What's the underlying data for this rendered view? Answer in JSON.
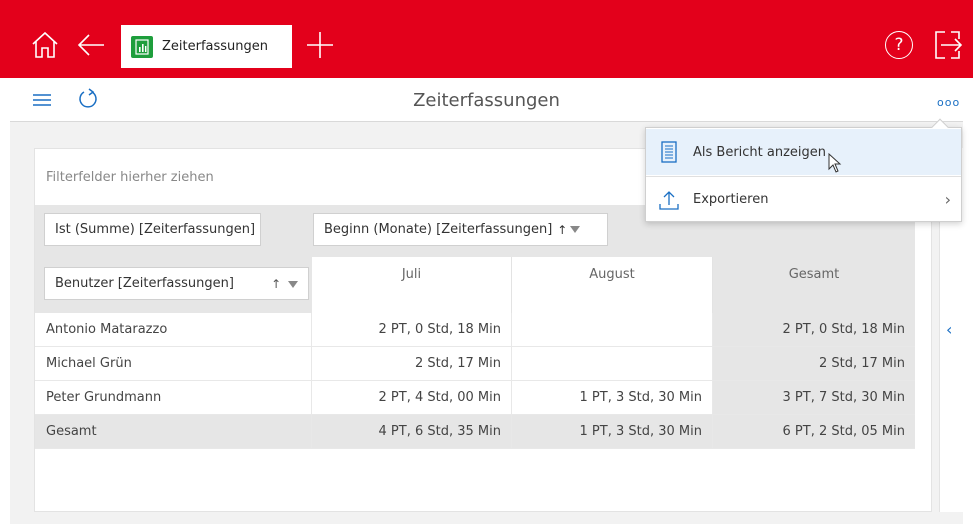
{
  "topbar": {
    "tab_label": "Zeiterfassungen",
    "help_glyph": "?",
    "accent_color": "#e3001b",
    "icons": [
      "home-icon",
      "back-arrow-icon",
      "spreadsheet-icon",
      "plus-icon",
      "help-icon",
      "logout-icon"
    ]
  },
  "header": {
    "title": "Zeiterfassungen",
    "more_glyph": "ooo"
  },
  "pivot": {
    "filter_placeholder": "Filterfelder hierher ziehen",
    "data_field": "Ist (Summe) [Zeiterfassungen]",
    "column_field": "Beginn (Monate) [Zeiterfassungen]",
    "row_field": "Benutzer [Zeiterfassungen]",
    "sort_glyph": "↑",
    "columns": [
      "Juli",
      "August",
      "Gesamt"
    ],
    "rows": [
      {
        "name": "Antonio Matarazzo",
        "juli": "2 PT, 0 Std, 18 Min",
        "august": "",
        "gesamt": "2 PT, 0 Std, 18 Min"
      },
      {
        "name": "Michael Grün",
        "juli": "2 Std, 17 Min",
        "august": "",
        "gesamt": "2 Std, 17 Min"
      },
      {
        "name": "Peter Grundmann",
        "juli": "2 PT, 4 Std, 00 Min",
        "august": "1 PT, 3 Std, 30 Min",
        "gesamt": "3 PT, 7 Std, 30 Min"
      },
      {
        "name": "Gesamt",
        "juli": "4 PT, 6 Std, 35 Min",
        "august": "1 PT, 3 Std, 30 Min",
        "gesamt": "6 PT, 2 Std, 05 Min"
      }
    ]
  },
  "menu": {
    "items": [
      {
        "label": "Als Bericht anzeigen",
        "icon": "report-icon"
      },
      {
        "label": "Exportieren",
        "icon": "export-icon"
      }
    ],
    "submenu_glyph": "›"
  },
  "side": {
    "collapse_glyph": "‹"
  }
}
